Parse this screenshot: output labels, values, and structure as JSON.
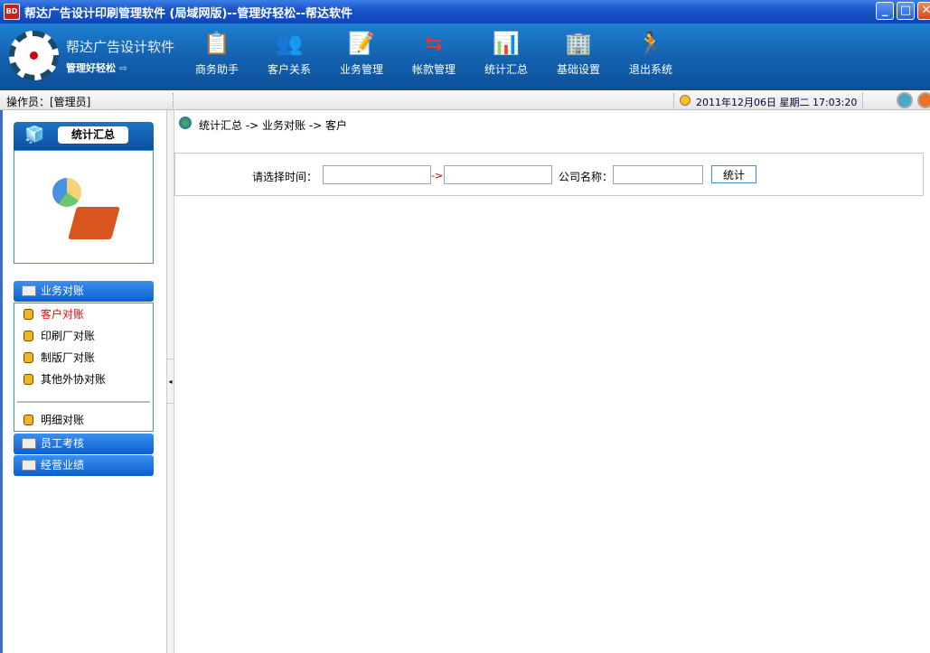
{
  "window": {
    "logo": "BD",
    "title": "帮达广告设计印刷管理软件 (局域网版)--管理好轻松--帮达软件",
    "min": "_",
    "max": "□",
    "close": "✕"
  },
  "brand": {
    "name": "帮达广告设计软件",
    "slogan": "管理好轻松"
  },
  "nav": [
    {
      "label": "商务助手",
      "icon": "📋"
    },
    {
      "label": "客户关系",
      "icon": "👥"
    },
    {
      "label": "业务管理",
      "icon": "📝"
    },
    {
      "label": "帐款管理",
      "icon": "⇆"
    },
    {
      "label": "统计汇总",
      "icon": "📊"
    },
    {
      "label": "基础设置",
      "icon": "🏢"
    },
    {
      "label": "退出系统",
      "icon": "🏃"
    }
  ],
  "status": {
    "operator": "操作员：[管理员]",
    "datetime": "2011年12月06日  星期二  17:03:20"
  },
  "sidebar": {
    "panel_title": "统计汇总",
    "groups": [
      {
        "label": "业务对账",
        "items": [
          "客户对账",
          "印刷厂对账",
          "制版厂对账",
          "其他外协对账"
        ],
        "extra": "明细对账",
        "active": "客户对账"
      },
      {
        "label": "员工考核"
      },
      {
        "label": "经营业绩"
      }
    ]
  },
  "breadcrumb": "统计汇总  ->  业务对账  ->  客户",
  "filter": {
    "time_label": "请选择时间：",
    "arrow": "->",
    "company_label": "公司名称：",
    "start": "",
    "end": "",
    "company": "",
    "submit": "统计"
  },
  "colors": {
    "active": "#ff0000"
  }
}
